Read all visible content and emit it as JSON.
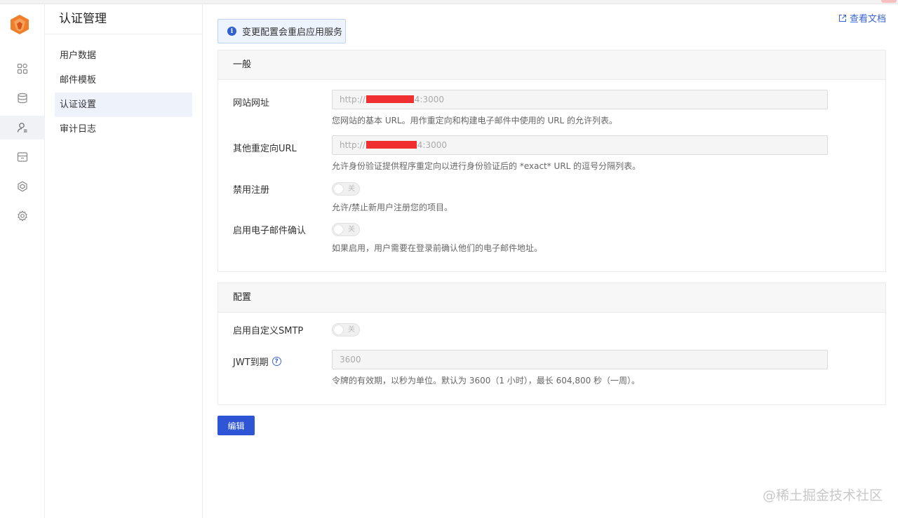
{
  "colors": {
    "accent": "#2d55d6",
    "link": "#3a63d6",
    "notice_bg": "#eef4fe",
    "redaction": "#f03030",
    "logo": "#f07e2a"
  },
  "rail": {
    "logo_icon": "orange-fox-logo",
    "items": [
      {
        "icon": "apps-grid-icon",
        "active": false
      },
      {
        "icon": "database-icon",
        "active": false
      },
      {
        "icon": "user-auth-icon",
        "active": true
      },
      {
        "icon": "storage-box-icon",
        "active": false
      },
      {
        "icon": "hexagon-icon",
        "active": false
      },
      {
        "icon": "gear-icon",
        "active": false
      }
    ]
  },
  "menu": {
    "title": "认证管理",
    "items": [
      {
        "label": "用户数据",
        "active": false
      },
      {
        "label": "邮件模板",
        "active": false
      },
      {
        "label": "认证设置",
        "active": true
      },
      {
        "label": "审计日志",
        "active": false
      }
    ]
  },
  "header": {
    "doc_link": "查看文档"
  },
  "notice": {
    "text": "变更配置会重启应用服务"
  },
  "general": {
    "title": "一般",
    "site_url": {
      "label": "网站网址",
      "value_prefix": "http://",
      "value_suffix": "4:3000",
      "help": "您网站的基本 URL。用作重定向和构建电子邮件中使用的 URL 的允许列表。"
    },
    "redirect_url": {
      "label": "其他重定向URL",
      "value_prefix": "http://",
      "value_suffix": "4:3000",
      "help": "允许身份验证提供程序重定向以进行身份验证后的 *exact* URL 的逗号分隔列表。"
    },
    "disable_signup": {
      "label": "禁用注册",
      "toggle_text": "关",
      "help": "允许/禁止新用户注册您的项目。"
    },
    "email_confirm": {
      "label": "启用电子邮件确认",
      "toggle_text": "关",
      "help": "如果启用，用户需要在登录前确认他们的电子邮件地址。"
    }
  },
  "config": {
    "title": "配置",
    "custom_smtp": {
      "label": "启用自定义SMTP",
      "toggle_text": "关"
    },
    "jwt_expiry": {
      "label": "JWT到期",
      "value": "3600",
      "help": "令牌的有效期，以秒为单位。默认为 3600（1 小时），最长 604,800 秒（一周）。"
    }
  },
  "actions": {
    "edit_label": "编辑"
  },
  "watermark": "@稀土掘金技术社区"
}
